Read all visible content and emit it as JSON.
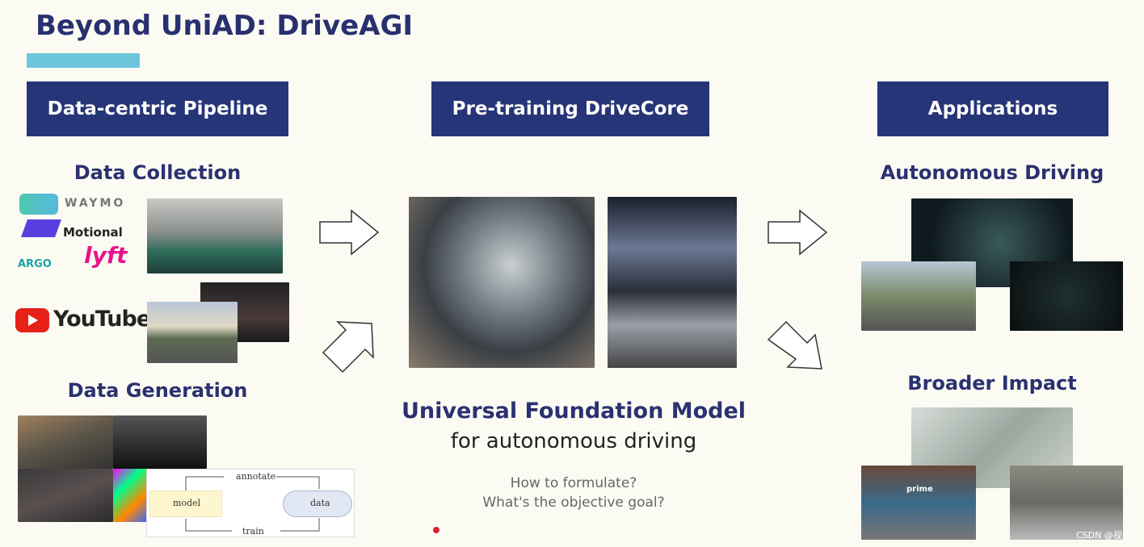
{
  "title": "Beyond UniAD: DriveAGI",
  "headers": {
    "pipeline": "Data-centric Pipeline",
    "pretraining": "Pre-training DriveCore",
    "applications": "Applications"
  },
  "pipeline": {
    "collection_label": "Data Collection",
    "generation_label": "Data Generation",
    "logos": {
      "waymo": "WAYMO",
      "motional": "Motional",
      "argo": "ARGO",
      "lyft": "lyft",
      "youtube": "YouTube"
    },
    "diagram": {
      "model": "model",
      "data": "data",
      "annotate": "annotate",
      "train": "train"
    }
  },
  "center": {
    "model_title": "Universal Foundation Model",
    "model_subtitle": "for autonomous driving",
    "question_1": "How to formulate?",
    "question_2": "What's the objective goal?"
  },
  "applications": {
    "autonomous_label": "Autonomous Driving",
    "broader_label": "Broader Impact",
    "prime": "prime"
  },
  "watermark": "CSDN @视言",
  "colors": {
    "header_bg": "#263577",
    "accent_bar": "#6ec6dc",
    "text": "#2b3170"
  }
}
